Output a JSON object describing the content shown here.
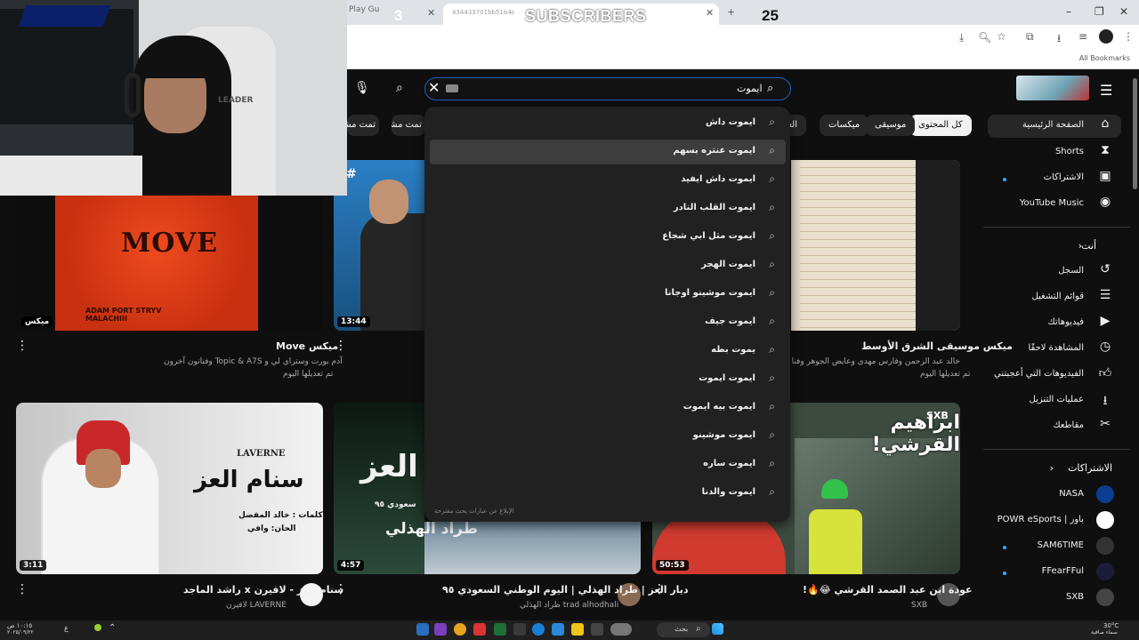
{
  "overlay": {
    "left_count": "3",
    "label": "SUBSCRIBERS",
    "right_count": "25",
    "cam_label": "LEADER"
  },
  "browser": {
    "other_tab": "Play Gu",
    "active_tab": "434433701bb51b4c",
    "all_bookmarks": "All Bookmarks"
  },
  "search": {
    "value": "ايموت",
    "suggestions": [
      "ايموت داش",
      "ايموت عنتره بسهم",
      "ايموت داش ايفيد",
      "ايموت القلب النادر",
      "ايموت مثل ابي شجاع",
      "ايموت الهجر",
      "ايموت موشينو اوجانا",
      "ايموت جيف",
      "يموت بطه",
      "ايموت ايموت",
      "ايموت بيه ايموت",
      "ايموت موشينو",
      "ايموت ساره",
      "ايموت والدنا"
    ],
    "report": "الإبلاغ عن عبارات بحث مقترحة"
  },
  "chips": [
    {
      "label": "كل المحتوى",
      "active": true
    },
    {
      "label": "موسيقى",
      "active": false
    },
    {
      "label": "ميكسات",
      "active": false
    },
    {
      "label": "العاب",
      "active": false
    },
    {
      "label": "تمت مشاهدتها مؤخرًا",
      "active": false
    },
    {
      "label": "تمت مشا",
      "active": false
    }
  ],
  "sidebar": {
    "main": [
      {
        "label": "الصفحة الرئيسية",
        "icon": "home-icon"
      },
      {
        "label": "Shorts",
        "icon": "shorts-icon"
      },
      {
        "label": "الاشتراكات",
        "icon": "subscriptions-icon"
      },
      {
        "label": "YouTube Music",
        "icon": "music-icon"
      }
    ],
    "you_heading": "أنت",
    "you": [
      {
        "label": "السجل",
        "icon": "history-icon"
      },
      {
        "label": "قوائم التشغيل",
        "icon": "playlists-icon"
      },
      {
        "label": "فيديوهاتك",
        "icon": "your-videos-icon"
      },
      {
        "label": "المشاهدة لاحقًا",
        "icon": "watch-later-icon"
      },
      {
        "label": "الفيديوهات التي أعجبتني",
        "icon": "liked-icon"
      },
      {
        "label": "عمليات التنزيل",
        "icon": "downloads-icon"
      },
      {
        "label": "مقاطعك",
        "icon": "clips-icon"
      }
    ],
    "subs_heading": "الاشتراكات",
    "subs": [
      {
        "label": "NASA",
        "color": "#0b3d91"
      },
      {
        "label": "باور | POWR eSports",
        "color": "#ffffff"
      },
      {
        "label": "SAM6TIME",
        "color": "#333333"
      },
      {
        "label": "FFearFFul",
        "color": "#1c1c3a"
      },
      {
        "label": "SXB",
        "color": "#444444"
      }
    ]
  },
  "videos": [
    {
      "title": "ميكس Move",
      "meta1": "آدم بورت وستراي لي و Topic & A7S وفنانون آخرون",
      "meta2": "تم تعديلها اليوم",
      "duration": "ميكس",
      "thumb_text": "MOVE",
      "thumb_sub": "ADAM PORT STRYV MALACHIII"
    },
    {
      "title": "",
      "meta1": "",
      "meta2": "",
      "duration": "13:44"
    },
    {
      "title": "ميكس موسيقى الشرق الأوسط",
      "meta1": "خالد عبد الرحمن وفارس مهدي وعايض الجوهر وفنانون آخرون",
      "meta2": "تم تعديلها اليوم",
      "duration": ""
    },
    {
      "title": "سنام العز - لافيرن x راشد الماجد",
      "meta1": "LAVERNE لافيرن",
      "meta2": "",
      "duration": "3:11",
      "thumb_text": "سنام العز",
      "thumb_sub": "كلمات : خالد المفضل",
      "thumb_sub2": "الحان: وافي",
      "thumb_brand": "LAVERNE"
    },
    {
      "title": "ديار العز | طراد الهذلي | اليوم الوطني السعودي ٩٥",
      "meta1": "trad alhodhali طراد الهذلي",
      "meta2": "",
      "duration": "4:57",
      "thumb_text": "العز",
      "thumb_sub": "طراد الهذلي",
      "thumb_sub2": "سعودي ٩٥"
    },
    {
      "title": "عودة ابن عبد الصمد القرشي 😂🔥!",
      "meta1": "SXB",
      "meta2": "",
      "duration": "50:53",
      "thumb_text": "ابراهيم القرشي!",
      "thumb_brand": "SXB"
    }
  ],
  "taskbar": {
    "search": "بحث",
    "time": "١٠:١٥ ص",
    "date": "٢٠٢٥/٠٩/٢٢",
    "weather": "30°C",
    "weather_desc": "سماء صافية",
    "lang": "ع"
  }
}
